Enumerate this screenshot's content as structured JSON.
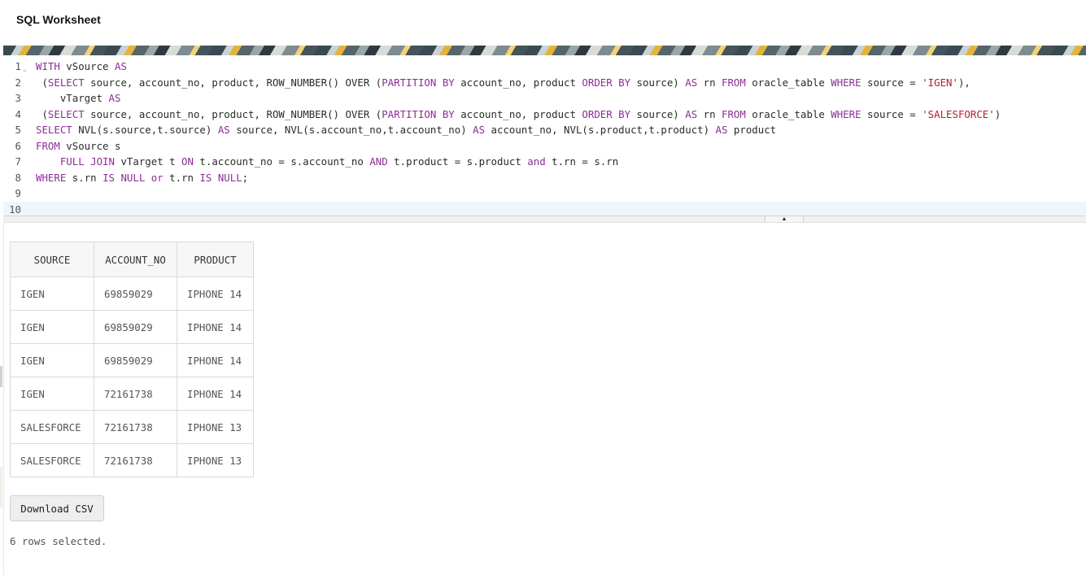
{
  "header": {
    "title": "SQL Worksheet"
  },
  "editor": {
    "lines": [
      {
        "num": "1"
      },
      {
        "num": "2"
      },
      {
        "num": "3"
      },
      {
        "num": "4"
      },
      {
        "num": "5"
      },
      {
        "num": "6"
      },
      {
        "num": "7"
      },
      {
        "num": "8"
      },
      {
        "num": "9"
      },
      {
        "num": "10"
      }
    ],
    "code": {
      "l1": [
        "WITH",
        " vSource ",
        "AS"
      ],
      "l2": [
        " (",
        "SELECT",
        " source, account_no, product, ROW_NUMBER() OVER (",
        "PARTITION BY",
        " account_no, product ",
        "ORDER BY",
        " source) ",
        "AS",
        " rn ",
        "FROM",
        " oracle_table ",
        "WHERE",
        " source = ",
        "'IGEN'",
        "),"
      ],
      "l3": [
        "    vTarget ",
        "AS"
      ],
      "l4": [
        " (",
        "SELECT",
        " source, account_no, product, ROW_NUMBER() OVER (",
        "PARTITION BY",
        " account_no, product ",
        "ORDER BY",
        " source) ",
        "AS",
        " rn ",
        "FROM",
        " oracle_table ",
        "WHERE",
        " source = ",
        "'SALESFORCE'",
        ")"
      ],
      "l5": [
        "SELECT",
        " NVL(s.source,t.source) ",
        "AS",
        " source, NVL(s.account_no,t.account_no) ",
        "AS",
        " account_no, NVL(s.product,t.product) ",
        "AS",
        " product"
      ],
      "l6": [
        "FROM",
        " vSource s"
      ],
      "l7": [
        "    ",
        "FULL JOIN",
        " vTarget t ",
        "ON",
        " t.account_no = s.account_no ",
        "AND",
        " t.product = s.product ",
        "and",
        " t.rn = s.rn"
      ],
      "l8": [
        "WHERE",
        " s.rn ",
        "IS NULL",
        " ",
        "or",
        " t.rn ",
        "IS NULL",
        ";"
      ]
    }
  },
  "results": {
    "columns": [
      "SOURCE",
      "ACCOUNT_NO",
      "PRODUCT"
    ],
    "rows": [
      [
        "IGEN",
        "69859029",
        "IPHONE 14"
      ],
      [
        "IGEN",
        "69859029",
        "IPHONE 14"
      ],
      [
        "IGEN",
        "69859029",
        "IPHONE 14"
      ],
      [
        "IGEN",
        "72161738",
        "IPHONE 14"
      ],
      [
        "SALESFORCE",
        "72161738",
        "IPHONE 13"
      ],
      [
        "SALESFORCE",
        "72161738",
        "IPHONE 13"
      ]
    ]
  },
  "actions": {
    "download_label": "Download CSV"
  },
  "status": {
    "text": "6 rows selected."
  },
  "icons": {
    "fold": "chevron-down-icon",
    "splitter": "caret-up-icon"
  },
  "colors": {
    "keyword": "#8c2d95",
    "string": "#b0202a",
    "active_line": "#eef6fb"
  }
}
